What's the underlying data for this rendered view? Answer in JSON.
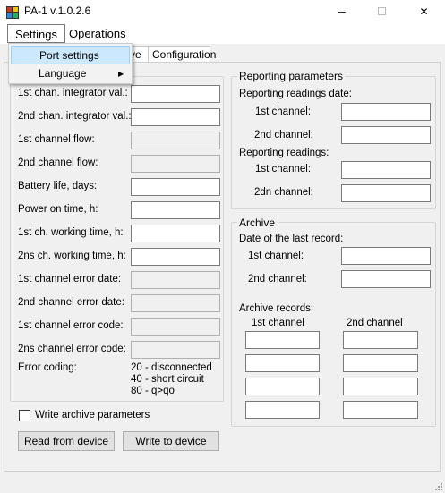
{
  "window": {
    "title": "PA-1 v.1.0.2.6",
    "minimize_glyph": "─",
    "maximize_glyph": "☐",
    "close_glyph": "✕"
  },
  "menu": {
    "settings": "Settings",
    "operations": "Operations",
    "dropdown": {
      "port_settings": "Port settings",
      "language": "Language",
      "submenu_arrow": "▶"
    }
  },
  "tabs": {
    "partial_label": "ve",
    "configuration": "Configuration"
  },
  "left": {
    "rows": [
      {
        "label": "1st chan. integrator val.:",
        "readonly": false,
        "value": ""
      },
      {
        "label": "2nd chan. integrator val.:",
        "readonly": false,
        "value": ""
      },
      {
        "label": "1st channel flow:",
        "readonly": true,
        "value": ""
      },
      {
        "label": "2nd channel flow:",
        "readonly": true,
        "value": ""
      },
      {
        "label": "Battery life, days:",
        "readonly": false,
        "value": ""
      },
      {
        "label": "Power on time, h:",
        "readonly": false,
        "value": ""
      },
      {
        "label": "1st ch. working time, h:",
        "readonly": false,
        "value": ""
      },
      {
        "label": "2ns ch. working time, h:",
        "readonly": false,
        "value": ""
      },
      {
        "label": "1st channel error date:",
        "readonly": true,
        "value": ""
      },
      {
        "label": "2nd channel error date:",
        "readonly": true,
        "value": ""
      },
      {
        "label": "1st channel error code:",
        "readonly": true,
        "value": ""
      },
      {
        "label": "2ns channel error code:",
        "readonly": true,
        "value": ""
      }
    ],
    "error_coding_label": "Error coding:",
    "error_codes": [
      "20 - disconnected",
      "40 - short circuit",
      "80 - q>qo"
    ]
  },
  "reporting": {
    "title": "Reporting parameters",
    "date_heading": "Reporting readings date:",
    "date_ch1": "1st channel:",
    "date_ch2": "2nd channel:",
    "readings_heading": "Reporting readings:",
    "readings_ch1": "1st channel:",
    "readings_ch2": "2dn channel:"
  },
  "archive": {
    "title": "Archive",
    "last_record_heading": "Date of the last record:",
    "ch1": "1st channel:",
    "ch2": "2nd channel:",
    "records_heading": "Archive records:",
    "col1": "1st channel",
    "col2": "2nd channel"
  },
  "bottom": {
    "write_archive": "Write archive parameters",
    "read_button": "Read from device",
    "write_button": "Write to device"
  }
}
